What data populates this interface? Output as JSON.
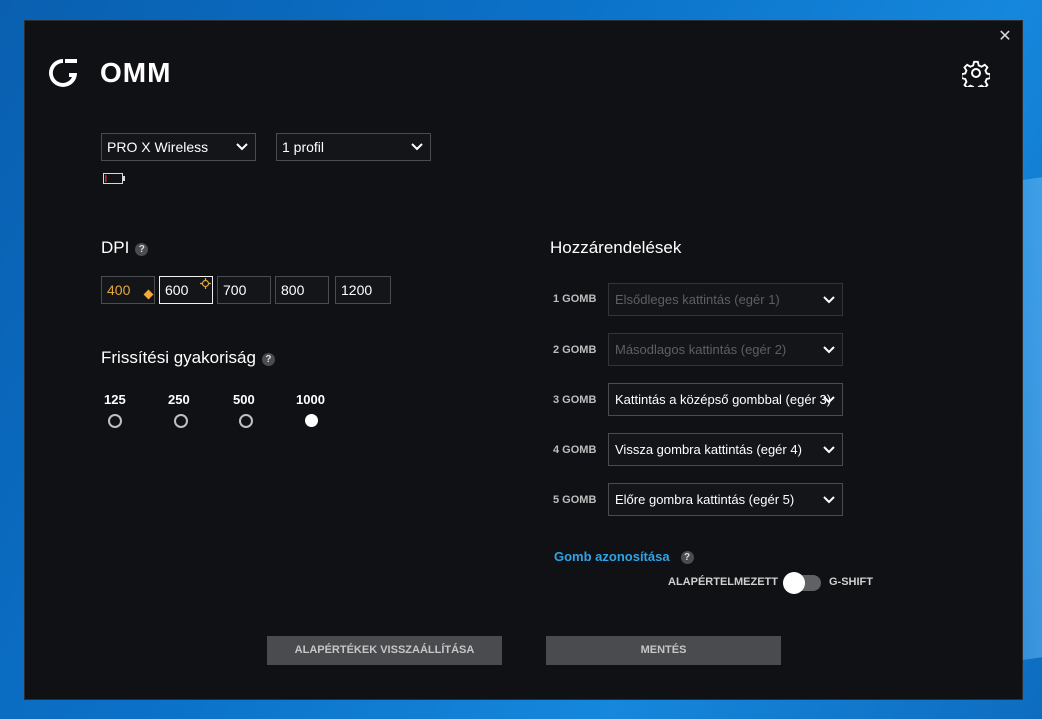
{
  "window": {
    "close_glyph": "✕"
  },
  "header": {
    "app_title": "OMM",
    "logo_icon": "logitech-g-icon",
    "settings_icon": "gear-icon"
  },
  "device_select": {
    "value": "PRO X Wireless"
  },
  "profile_select": {
    "value": "1 profil"
  },
  "battery": {
    "icon": "battery-low-icon",
    "level": 0.1,
    "color": "#d3202f"
  },
  "dpi": {
    "title": "DPI",
    "help": "?",
    "levels": [
      "400",
      "600",
      "700",
      "800",
      "1200"
    ],
    "default_level": "400",
    "active_level": "600",
    "default_color": "#e8a93a"
  },
  "report_rate": {
    "title": "Frissítési gyakoriság",
    "help": "?",
    "options": [
      "125",
      "250",
      "500",
      "1000"
    ],
    "selected": "1000"
  },
  "assignments": {
    "title": "Hozzárendelések",
    "buttons": [
      {
        "label": "1 GOMB",
        "value": "Elsődleges kattintás (egér 1)",
        "disabled": true
      },
      {
        "label": "2 GOMB",
        "value": "Másodlagos kattintás (egér 2)",
        "disabled": true
      },
      {
        "label": "3 GOMB",
        "value": "Kattintás a középső gombbal (egér 3)",
        "disabled": false
      },
      {
        "label": "4 GOMB",
        "value": "Vissza gombra kattintás (egér 4)",
        "disabled": false
      },
      {
        "label": "5 GOMB",
        "value": "Előre gombra kattintás (egér 5)",
        "disabled": false
      }
    ],
    "identify_link": "Gomb azonosítása",
    "help": "?",
    "mode_left": "ALAPÉRTELMEZETT",
    "mode_right": "G-SHIFT",
    "gshift_on": false
  },
  "footer": {
    "reset_label": "ALAPÉRTÉKEK VISSZAÁLLÍTÁSA",
    "save_label": "MENTÉS"
  },
  "colors": {
    "accent_link": "#2fa3e6",
    "window_bg": "#101114"
  }
}
